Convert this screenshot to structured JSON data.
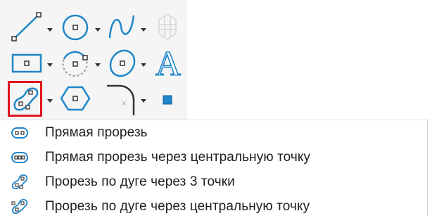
{
  "toolbar": {
    "rows": [
      [
        "line-tool",
        "circle-tool",
        "spline-tool",
        "grid-tool"
      ],
      [
        "rectangle-tool",
        "arc-tool",
        "ellipse-tool",
        "text-tool"
      ],
      [
        "slot-tool",
        "polygon-tool",
        "fillet-tool",
        "point-tool"
      ]
    ],
    "text_tool_glyph": "A",
    "selected_tool": "slot-tool",
    "accent_color": "#1e86c8",
    "selection_color": "#e0161b"
  },
  "menu": {
    "items": [
      {
        "label": "Прямая прорезь",
        "icon": "straight-slot-icon"
      },
      {
        "label": "Прямая прорезь через центральную точку",
        "icon": "centerpoint-straight-slot-icon"
      },
      {
        "label": "Прорезь по дуге через 3 точки",
        "icon": "three-point-arc-slot-icon"
      },
      {
        "label": "Прорезь по дуге через центральную точку",
        "icon": "centerpoint-arc-slot-icon"
      }
    ]
  }
}
